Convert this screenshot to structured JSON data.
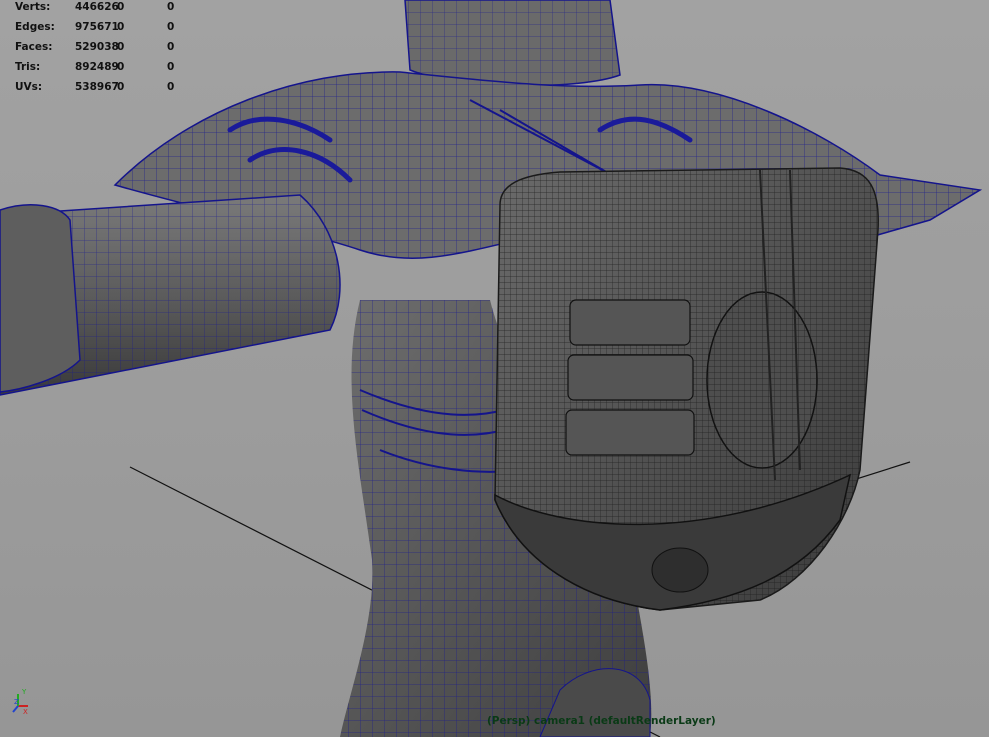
{
  "hud": {
    "rows": [
      {
        "label": "Verts:",
        "total": "446626",
        "selected": "0",
        "component": "0"
      },
      {
        "label": "Edges:",
        "total": "975671",
        "selected": "0",
        "component": "0"
      },
      {
        "label": "Faces:",
        "total": "529038",
        "selected": "0",
        "component": "0"
      },
      {
        "label": "Tris:",
        "total": "892489",
        "selected": "0",
        "component": "0"
      },
      {
        "label": "UVs:",
        "total": "538967",
        "selected": "0",
        "component": "0"
      }
    ]
  },
  "viewport": {
    "camera_label": "(Persp) camera1  (defaultRenderLayer)",
    "axis_icon": "view-axis-gizmo-icon",
    "colors": {
      "background": "#9c9c9c",
      "mesh_fill": "#5a5a5a",
      "wireframe": "#14148c",
      "grid": "#111111",
      "camera_label": "#0a3a16"
    }
  }
}
